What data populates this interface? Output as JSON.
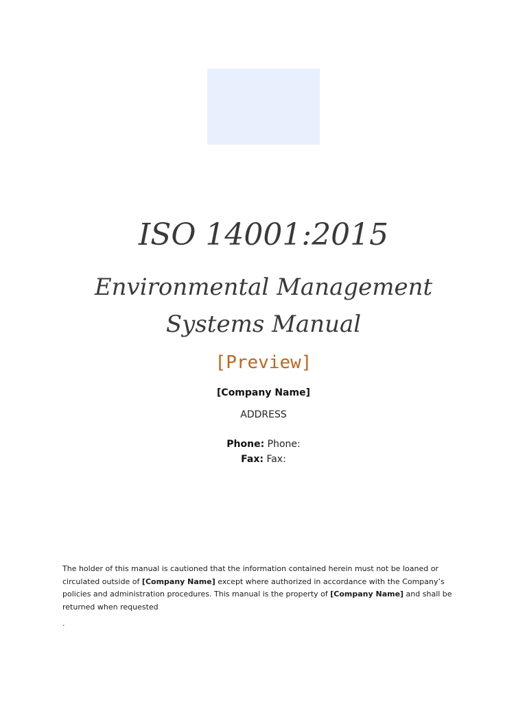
{
  "document": {
    "title": "ISO 14001:2015",
    "subtitle_line1": "Environmental Management",
    "subtitle_line2": "Systems Manual",
    "preview_label": "[Preview]",
    "company_name": "[Company Name]",
    "address": "ADDRESS",
    "phone_label": "Phone:",
    "phone_value": "Phone:",
    "fax_label": "Fax:",
    "fax_value": "Fax:",
    "notice": {
      "part1": "The holder of this manual is cautioned that the information contained herein must not be loaned or circulated outside of ",
      "company1": "[Company Name]",
      "part2": " except where authorized in accordance with the Company’s policies and administration procedures. This manual is the property of ",
      "company2": "[Company Name]",
      "part3": " and shall be returned when requested"
    },
    "trailing_mark": "."
  },
  "colors": {
    "logo_placeholder": "#e8f0fd",
    "preview_accent": "#c0651d",
    "title_text": "#3a3a3a"
  }
}
